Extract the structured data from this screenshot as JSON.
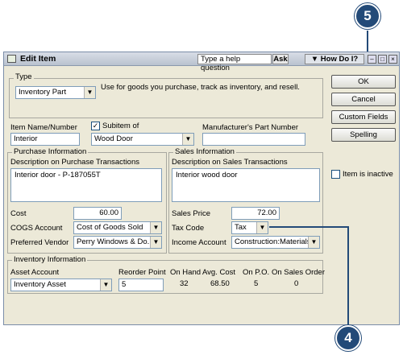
{
  "window": {
    "title": "Edit Item",
    "help_placeholder": "Type a help question",
    "ask_label": "Ask",
    "how_do_i_label": "How Do I?"
  },
  "type_group": {
    "label": "Type",
    "value": "Inventory Part",
    "description": "Use for goods you purchase, track as inventory, and resell."
  },
  "buttons": {
    "ok": "OK",
    "cancel": "Cancel",
    "custom_fields": "Custom Fields",
    "spelling": "Spelling"
  },
  "item": {
    "name_label": "Item Name/Number",
    "name_value": "Interior",
    "subitem_label": "Subitem of",
    "subitem_checked": true,
    "subitem_value": "Wood Door",
    "mfr_label": "Manufacturer's Part Number",
    "mfr_value": ""
  },
  "inactive": {
    "label": "Item is inactive",
    "checked": false
  },
  "purchase": {
    "group_label": "Purchase Information",
    "desc_label": "Description on Purchase Transactions",
    "desc_value": "Interior door - P-187055T",
    "cost_label": "Cost",
    "cost_value": "60.00",
    "cogs_label": "COGS Account",
    "cogs_value": "Cost of Goods Sold",
    "vendor_label": "Preferred Vendor",
    "vendor_value": "Perry Windows & Do..."
  },
  "sales": {
    "group_label": "Sales Information",
    "desc_label": "Description on Sales Transactions",
    "desc_value": "Interior wood door",
    "price_label": "Sales Price",
    "price_value": "72.00",
    "taxcode_label": "Tax Code",
    "taxcode_value": "Tax",
    "income_label": "Income Account",
    "income_value": "Construction:Materials"
  },
  "inventory": {
    "group_label": "Inventory Information",
    "asset_label": "Asset Account",
    "asset_value": "Inventory Asset",
    "reorder_label": "Reorder Point",
    "reorder_value": "5",
    "onhand_label": "On Hand",
    "onhand_value": "32",
    "avgcost_label": "Avg. Cost",
    "avgcost_value": "68.50",
    "onpo_label": "On P.O.",
    "onpo_value": "5",
    "onso_label": "On Sales Order",
    "onso_value": "0"
  },
  "callouts": {
    "top": "5",
    "bottom": "4"
  }
}
